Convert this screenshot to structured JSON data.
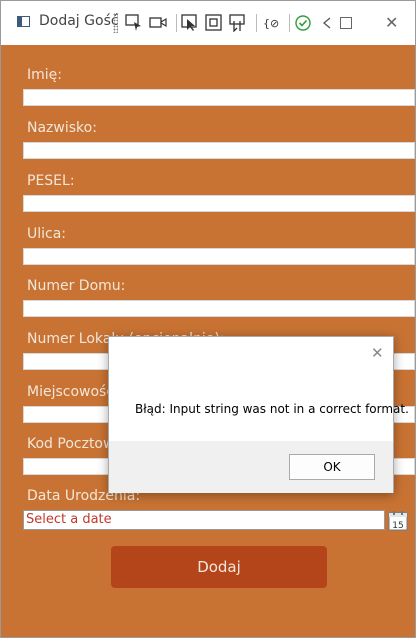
{
  "window": {
    "title": "Dodaj Gość"
  },
  "toolbar": {
    "icons": [
      "select-element-icon",
      "video-icon",
      "cursor-select-icon",
      "layout-adorner-icon",
      "track-focus-icon",
      "binding-failures-icon",
      "checkmark-icon",
      "collapse-icon"
    ]
  },
  "form": {
    "fields": [
      {
        "label": "Imię:",
        "value": ""
      },
      {
        "label": "Nazwisko:",
        "value": ""
      },
      {
        "label": "PESEL:",
        "value": ""
      },
      {
        "label": "Ulica:",
        "value": ""
      },
      {
        "label": "Numer Domu:",
        "value": ""
      },
      {
        "label": "Numer Lokalu (opcjonalnie):",
        "value": ""
      },
      {
        "label": "Miejscowość:",
        "value": ""
      },
      {
        "label": "Kod Pocztowy:",
        "value": ""
      }
    ],
    "date_label": "Data Urodzenia:",
    "date_placeholder": "Select a date",
    "calendar_day": "15",
    "submit_label": "Dodaj"
  },
  "dialog": {
    "message": "Błąd: Input string was not in a correct format.",
    "ok_label": "OK"
  },
  "colors": {
    "background": "#c87333",
    "button": "#b4451b",
    "label": "#f3e6d8"
  }
}
